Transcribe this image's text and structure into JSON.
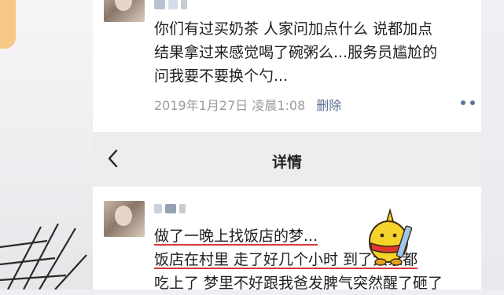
{
  "post_1": {
    "text_lines": [
      "你们有过买奶茶 人家问加点什么 说都加点",
      "结果拿过来感觉喝了碗粥么...服务员尴尬的",
      "问我要不要换个勺..."
    ],
    "date": "2019年1月27日 凌晨1:08",
    "delete_label": "删除"
  },
  "nav": {
    "back_glyph": "〈",
    "title": "详情"
  },
  "post_2": {
    "text_lines": [
      "做了一晚上找饭店的梦...",
      "饭店在村里 走了好几个小时 到了大家都",
      "吃上了 梦里不好跟我爸发脾气突然醒了砸了"
    ]
  },
  "colors": {
    "link_blue": "#5b6f91",
    "meta_gray": "#9a9a9a",
    "underline_red": "#d8383e",
    "nav_bg": "#ededed"
  },
  "icons": {
    "more": "more-dots-icon",
    "back": "chevron-left-icon",
    "sticker": "yellow-mascot-sticker"
  }
}
